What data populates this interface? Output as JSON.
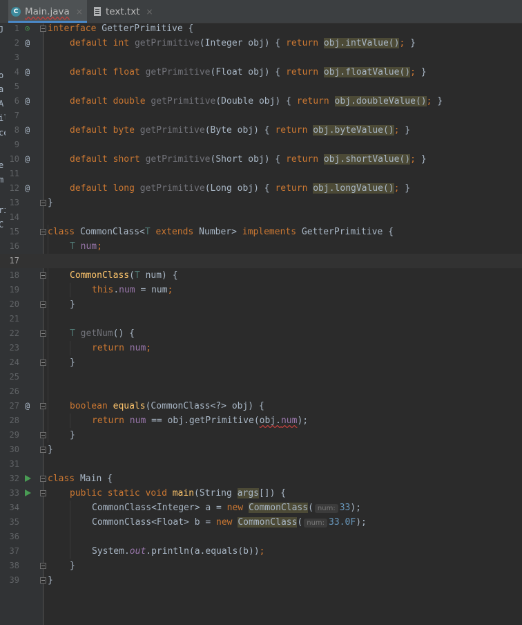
{
  "tabs": [
    {
      "label": "Main.java",
      "icon": "java-class-icon",
      "close": "×"
    },
    {
      "label": "text.txt",
      "icon": "text-file-icon",
      "close": "×"
    }
  ],
  "left_strip_fragments": [
    "J",
    "o",
    "a",
    "A",
    "il",
    "ce",
    "e",
    "m",
    "ri",
    "C"
  ],
  "gutter_markers": {
    "override": "@",
    "interface_impl": "⊙"
  },
  "code": {
    "l1": [
      "interface",
      " GetterPrimitive {"
    ],
    "l2": [
      "default",
      " ",
      "int",
      " ",
      "getPrimitive",
      "(Integer obj) { ",
      "return",
      " ",
      "obj.intValue()",
      ";",
      " }"
    ],
    "l4": [
      "default",
      " ",
      "float",
      " ",
      "getPrimitive",
      "(Float obj) { ",
      "return",
      " ",
      "obj.floatValue()",
      ";",
      " }"
    ],
    "l6": [
      "default",
      " ",
      "double",
      " ",
      "getPrimitive",
      "(Double obj) { ",
      "return",
      " ",
      "obj.doubleValue()",
      ";",
      " }"
    ],
    "l8": [
      "default",
      " ",
      "byte",
      " ",
      "getPrimitive",
      "(Byte obj) { ",
      "return",
      " ",
      "obj.byteValue()",
      ";",
      " }"
    ],
    "l10": [
      "default",
      " ",
      "short",
      " ",
      "getPrimitive",
      "(Short obj) { ",
      "return",
      " ",
      "obj.shortValue()",
      ";",
      " }"
    ],
    "l12": [
      "default",
      " ",
      "long",
      " ",
      "getPrimitive",
      "(Long obj) { ",
      "return",
      " ",
      "obj.longValue()",
      ";",
      " }"
    ],
    "l13": [
      "}"
    ],
    "l15": [
      "class",
      " CommonClass<",
      "T",
      " ",
      "extends",
      " Number> ",
      "implements",
      " GetterPrimitive {"
    ],
    "l16": [
      "T",
      " ",
      "num",
      ";"
    ],
    "l18": [
      "CommonClass",
      "(",
      "T",
      " num) {"
    ],
    "l19": [
      "this",
      ".",
      "num",
      " = num",
      ";"
    ],
    "l20": [
      "}"
    ],
    "l22": [
      "T",
      " ",
      "getNum",
      "() {"
    ],
    "l23": [
      "return",
      " ",
      "num",
      ";"
    ],
    "l24": [
      "}"
    ],
    "l27": [
      "boolean",
      " ",
      "equals",
      "(CommonClass<?> obj) {"
    ],
    "l28": [
      "return",
      " ",
      "num",
      " == obj.getPrimitive(",
      "obj.",
      "num",
      ");"
    ],
    "l29": [
      "}"
    ],
    "l30": [
      "}"
    ],
    "l32": [
      "class",
      " Main {"
    ],
    "l33": [
      "public",
      " ",
      "static",
      " ",
      "void",
      " ",
      "main",
      "(String ",
      "args",
      "[]) {"
    ],
    "l34": [
      "CommonClass<Integer> a = ",
      "new",
      " ",
      "CommonClass",
      "(",
      "num:",
      "33",
      ");"
    ],
    "l35": [
      "CommonClass<Float> b = ",
      "new",
      " ",
      "CommonClass",
      "(",
      "num:",
      "33.0F",
      ");"
    ],
    "l37": [
      "System.",
      "out",
      ".println(a.equals(b))",
      ";"
    ],
    "l38": [
      "}"
    ],
    "l39": [
      "}"
    ]
  },
  "colors": {
    "background": "#2b2b2b",
    "keyword": "#cc7832",
    "method": "#ffc66d",
    "field": "#9876aa",
    "type_param": "#507874",
    "number": "#6897bb",
    "text": "#a9b7c6",
    "line_number": "#606366",
    "run_marker": "#499c54"
  }
}
